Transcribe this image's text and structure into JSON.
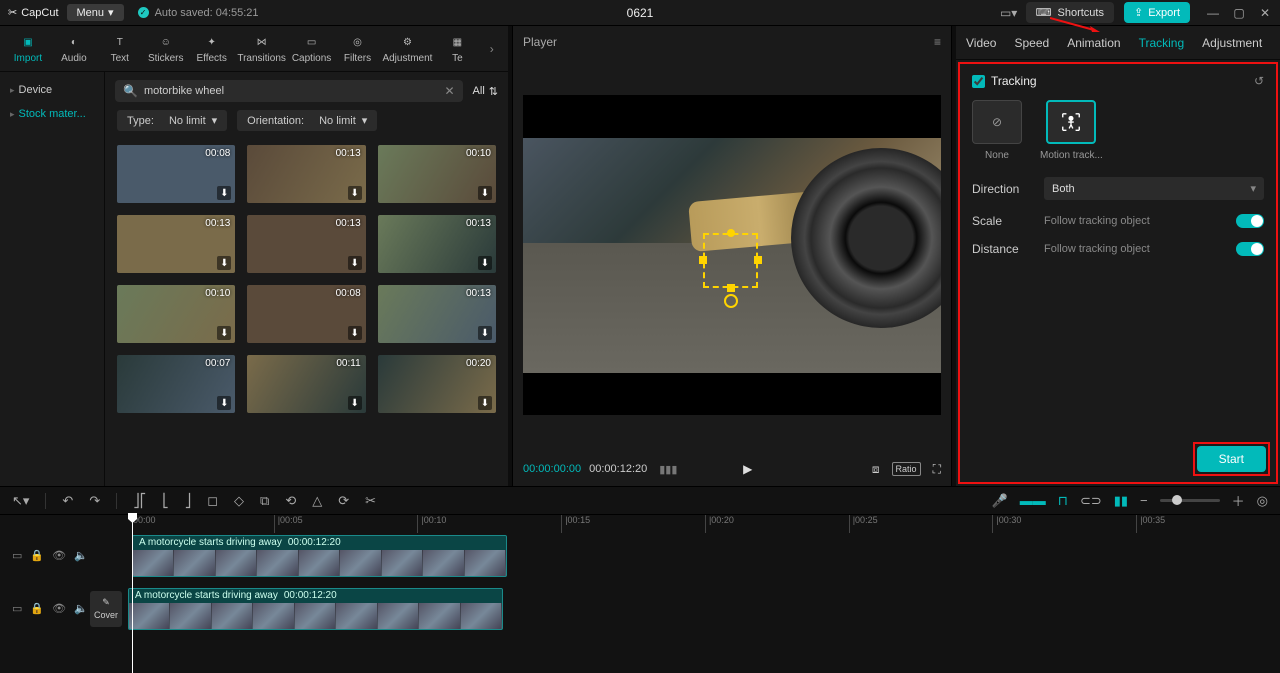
{
  "app": {
    "name": "CapCut",
    "menu": "Menu",
    "autosaved": "Auto saved: 04:55:21",
    "title": "0621"
  },
  "topright": {
    "shortcuts": "Shortcuts",
    "export": "Export"
  },
  "tools": [
    {
      "label": "Import",
      "active": true
    },
    {
      "label": "Audio"
    },
    {
      "label": "Text"
    },
    {
      "label": "Stickers"
    },
    {
      "label": "Effects"
    },
    {
      "label": "Transitions"
    },
    {
      "label": "Captions"
    },
    {
      "label": "Filters"
    },
    {
      "label": "Adjustment"
    },
    {
      "label": "Te"
    }
  ],
  "leftnav": {
    "device": "Device",
    "stock": "Stock mater..."
  },
  "search": {
    "value": "motorbike wheel",
    "all": "All"
  },
  "filters": {
    "type_lbl": "Type:",
    "type_val": "No limit",
    "orient_lbl": "Orientation:",
    "orient_val": "No limit"
  },
  "thumbs": [
    "00:08",
    "00:13",
    "00:10",
    "00:13",
    "00:13",
    "00:13",
    "00:10",
    "00:08",
    "00:13",
    "00:07",
    "00:11",
    "00:20"
  ],
  "player": {
    "label": "Player",
    "tc_current": "00:00:00:00",
    "tc_total": "00:00:12:20",
    "ratio": "Ratio"
  },
  "rtabs": [
    "Video",
    "Speed",
    "Animation",
    "Tracking",
    "Adjustment"
  ],
  "tracking": {
    "title": "Tracking",
    "mode_none": "None",
    "mode_motion": "Motion track...",
    "direction_lbl": "Direction",
    "direction_val": "Both",
    "scale_lbl": "Scale",
    "scale_sub": "Follow tracking object",
    "dist_lbl": "Distance",
    "dist_sub": "Follow tracking object",
    "start": "Start"
  },
  "ruler": [
    "00:00",
    "|00:05",
    "|00:10",
    "|00:15",
    "|00:20",
    "|00:25",
    "|00:30",
    "|00:35"
  ],
  "clip": {
    "label": "A motorcycle starts driving away",
    "dur": "00:00:12:20"
  },
  "cover": "Cover"
}
